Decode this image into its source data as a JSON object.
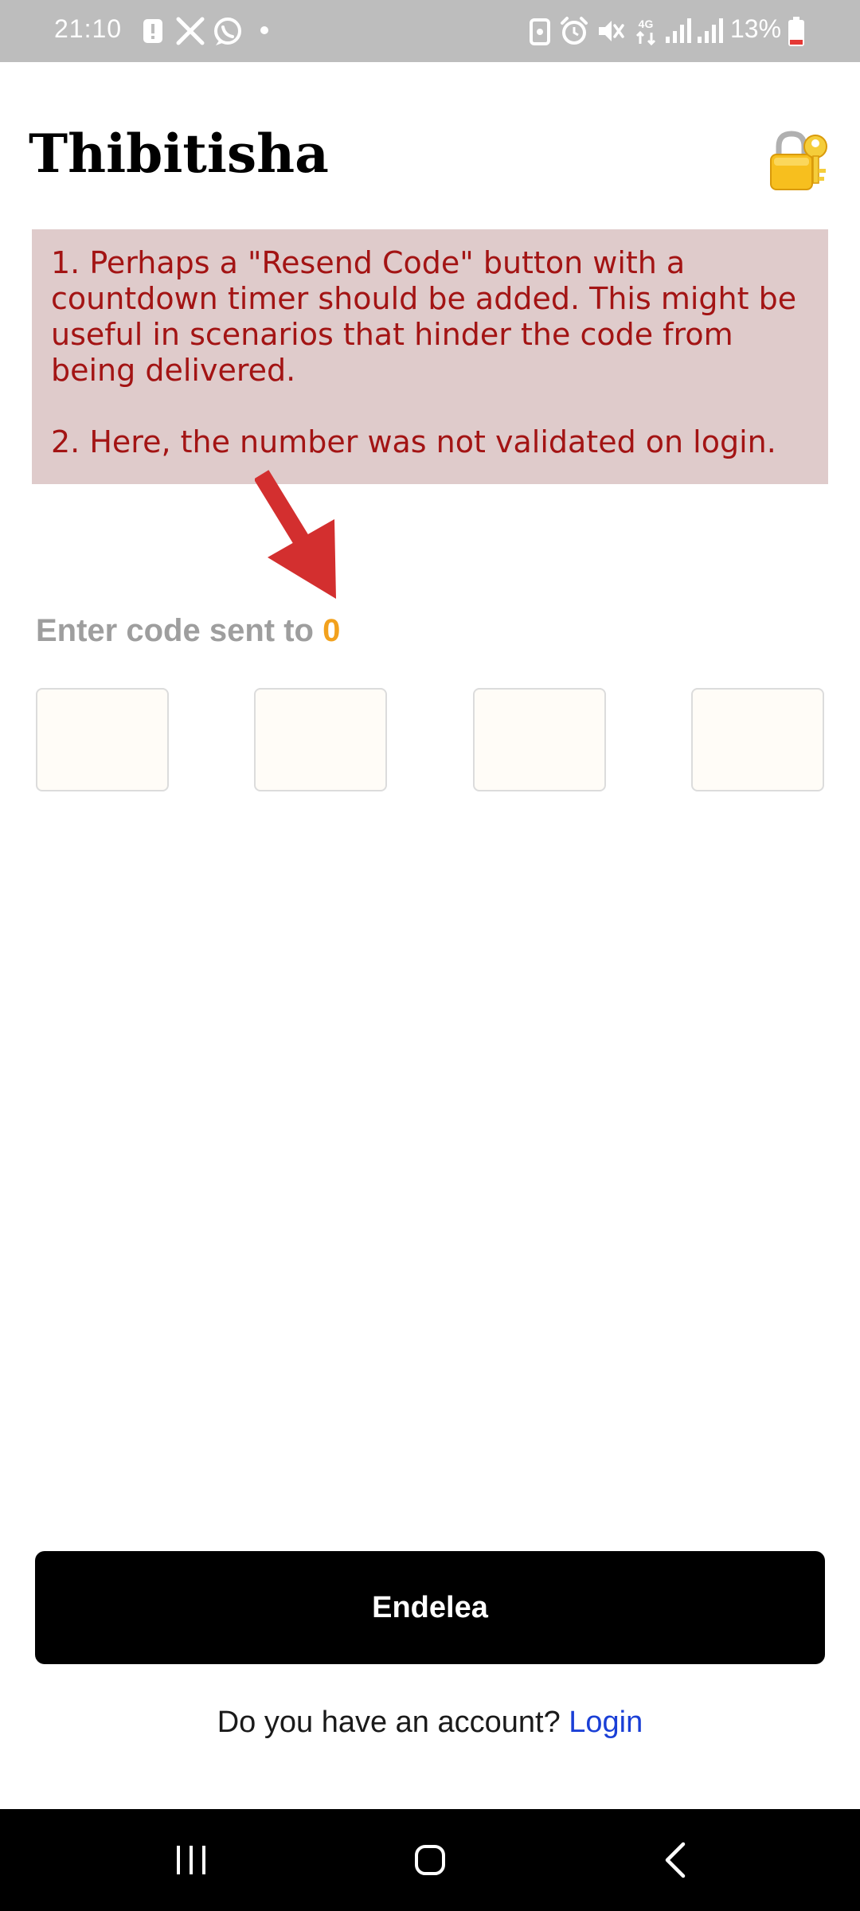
{
  "status_bar": {
    "time": "21:10",
    "battery": "13%",
    "left_icons": [
      "alert-icon",
      "x-icon",
      "whatsapp-icon",
      "dot-icon"
    ],
    "right_icons": [
      "nfc-icon",
      "alarm-icon",
      "mute-icon",
      "data-4g-icon",
      "signal-icon",
      "signal-icon",
      "battery-low-icon"
    ]
  },
  "header": {
    "title": "Thibitisha",
    "icon": "lock-with-key-icon"
  },
  "annotation": {
    "note_1": "1. Perhaps a \"Resend Code\" button with a countdown timer should be added. This might be useful in scenarios that hinder the code from being delivered.",
    "note_2": "2. Here, the number was not validated on login.",
    "text_color": "#a31414",
    "background": "#dfcbcb",
    "arrow_color": "#d32f2f"
  },
  "code_entry": {
    "prompt": "Enter code sent to ",
    "phone_number": "0",
    "digits": [
      "",
      "",
      "",
      ""
    ]
  },
  "actions": {
    "continue_label": "Endelea",
    "account_question": "Do you have an account? ",
    "login_label": "Login"
  },
  "colors": {
    "accent_number": "#f2a11d",
    "link": "#1a3fd6",
    "primary_button": "#000000"
  }
}
